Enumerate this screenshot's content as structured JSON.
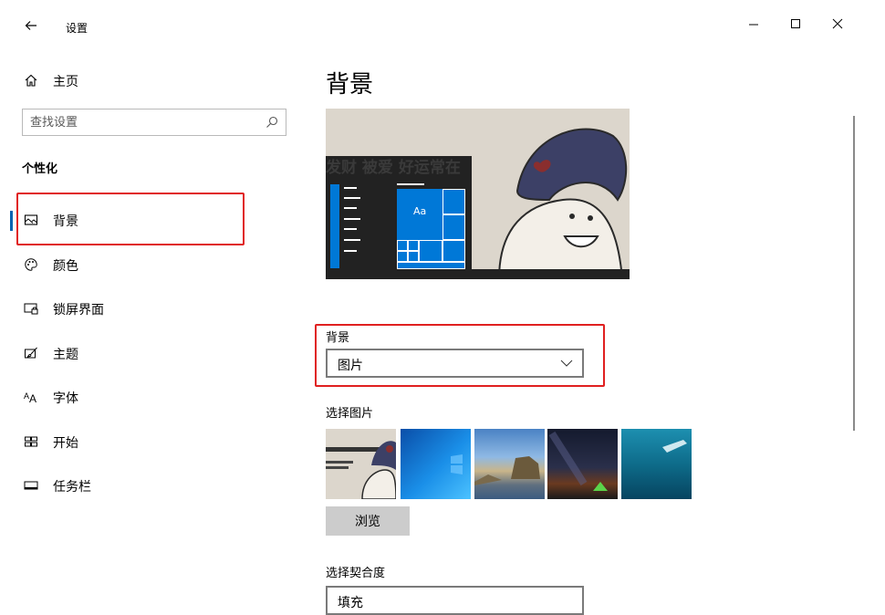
{
  "window": {
    "title": "设置",
    "controls": {
      "minimize": "minimize-icon",
      "maximize": "maximize-icon",
      "close": "close-icon"
    }
  },
  "sidebar": {
    "home_label": "主页",
    "search_placeholder": "查找设置",
    "section_header": "个性化",
    "items": [
      {
        "label": "背景",
        "icon": "picture-icon",
        "selected": true
      },
      {
        "label": "颜色",
        "icon": "palette-icon",
        "selected": false
      },
      {
        "label": "锁屏界面",
        "icon": "lock-screen-icon",
        "selected": false
      },
      {
        "label": "主题",
        "icon": "brush-icon",
        "selected": false
      },
      {
        "label": "字体",
        "icon": "font-icon",
        "selected": false
      },
      {
        "label": "开始",
        "icon": "start-icon",
        "selected": false
      },
      {
        "label": "任务栏",
        "icon": "taskbar-icon",
        "selected": false
      }
    ]
  },
  "main": {
    "page_title": "背景",
    "preview": {
      "picture_text": "发财 被爱 好运常在",
      "tile_label": "Aa"
    },
    "background_label": "背景",
    "background_value": "图片",
    "choose_picture_label": "选择图片",
    "thumbnails": [
      {
        "name": "cartoon-wallpaper"
      },
      {
        "name": "windows-blue-wallpaper"
      },
      {
        "name": "beach-rocks-wallpaper"
      },
      {
        "name": "night-sky-tent-wallpaper"
      },
      {
        "name": "underwater-swimmer-wallpaper"
      }
    ],
    "browse_label": "浏览",
    "choose_fit_label": "选择契合度",
    "fit_value": "填充"
  },
  "colors": {
    "accent": "#0078d7",
    "selection_bar": "#0063b1",
    "annotation_red": "#e02020"
  }
}
